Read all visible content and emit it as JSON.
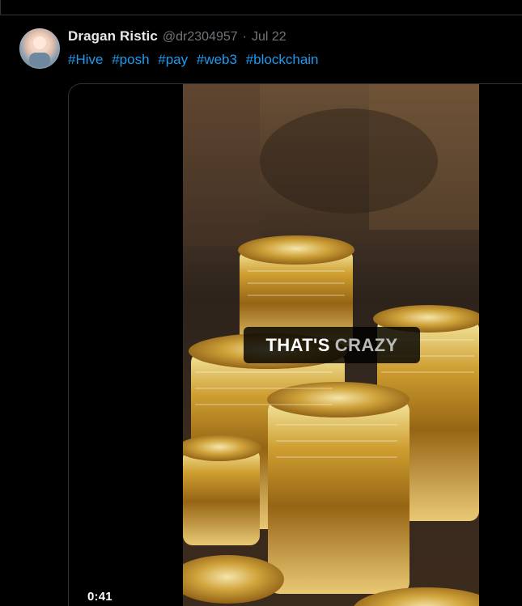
{
  "tweet": {
    "display_name": "Dragan Ristic",
    "handle": "@dr2304957",
    "separator": "·",
    "date": "Jul 22",
    "hashtags": [
      "#Hive",
      "#posh",
      "#pay",
      "#web3",
      "#blockchain"
    ]
  },
  "video": {
    "caption_left": "THAT'S",
    "caption_right": "CRAZY",
    "timestamp": "0:41"
  },
  "colors": {
    "background": "#000000",
    "text_primary": "#e7e9ea",
    "text_secondary": "#71767b",
    "link": "#1d9bf0",
    "border": "#2f3336"
  }
}
